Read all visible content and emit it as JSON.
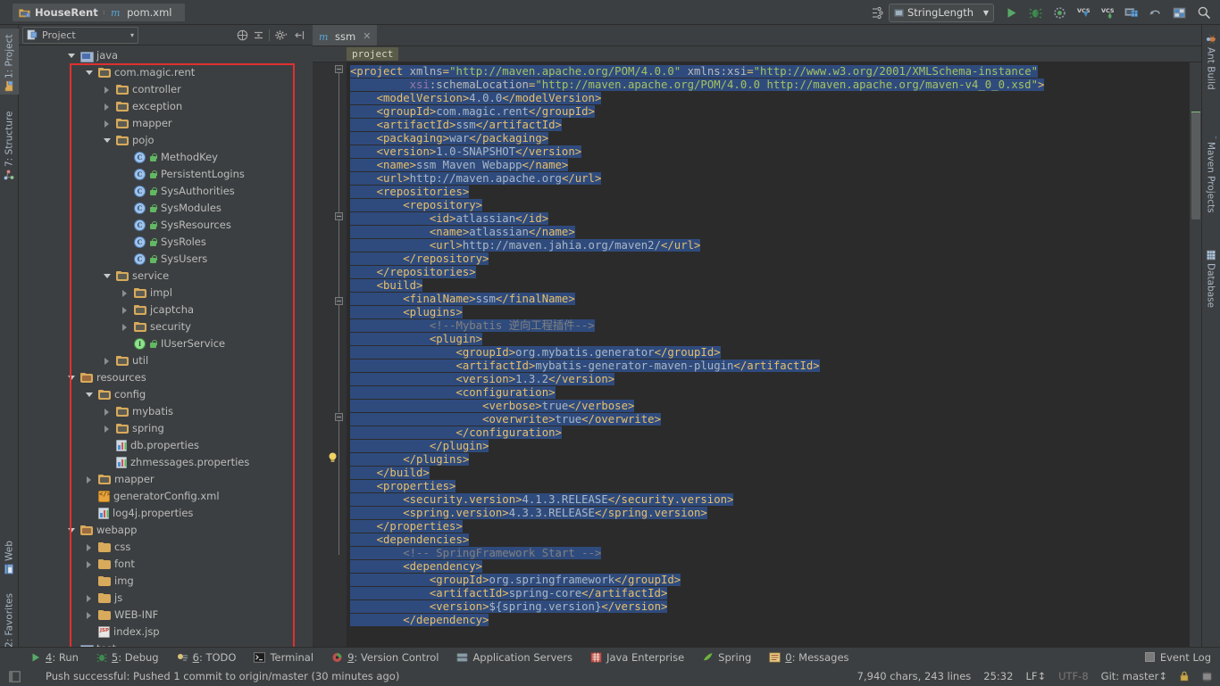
{
  "window": {
    "breadcrumb": [
      {
        "label": "HouseRent",
        "icon": "project-folder-icon"
      },
      {
        "label": "pom.xml",
        "icon": "maven-m-icon"
      }
    ],
    "separator": "›"
  },
  "toolbar": {
    "run_config": {
      "label": "StringLength",
      "caret": "▼"
    },
    "buttons": [
      {
        "name": "run-button",
        "glyph": "run"
      },
      {
        "name": "debug-button",
        "glyph": "debug"
      },
      {
        "name": "coverage-button",
        "glyph": "coverage"
      },
      {
        "name": "vcs-update-button",
        "glyph": "vcs-update"
      },
      {
        "name": "vcs-commit-button",
        "glyph": "vcs-commit"
      },
      {
        "name": "vcs-history-button",
        "glyph": "vcs-history"
      },
      {
        "name": "undo-button",
        "glyph": "undo"
      },
      {
        "name": "settings-button",
        "glyph": "settings"
      },
      {
        "name": "search-everywhere-button",
        "glyph": "search"
      }
    ],
    "left_icon": "toolbar-toggle-icon"
  },
  "left_tool_strip": [
    {
      "label": "1: Project",
      "selected": true,
      "icon": "project-icon"
    },
    {
      "label": "7: Structure",
      "selected": false,
      "icon": "structure-icon"
    },
    {
      "label": "Web",
      "selected": false,
      "icon": "web-icon"
    },
    {
      "label": "2: Favorites",
      "selected": false,
      "icon": "favorites-star-icon"
    }
  ],
  "right_tool_strip": [
    {
      "label": "Ant Build",
      "icon": "ant-icon"
    },
    {
      "label": "Maven Projects",
      "icon": "maven-m-icon"
    },
    {
      "label": "Database",
      "icon": "database-icon"
    }
  ],
  "project_panel": {
    "title": "Project",
    "title_caret": "▾",
    "header_icons": [
      {
        "name": "collapse-all-icon"
      },
      {
        "name": "expand-all-icon"
      },
      {
        "name": "settings-gear-icon"
      },
      {
        "name": "hide-panel-icon"
      }
    ],
    "tree": [
      {
        "depth": 1,
        "arrow": "open",
        "icon": "module-source-icon",
        "label": "java",
        "kind": "folder-src"
      },
      {
        "depth": 2,
        "arrow": "open",
        "icon": "package-icon",
        "label": "com.magic.rent",
        "kind": "folder-pkg"
      },
      {
        "depth": 3,
        "arrow": "closed",
        "icon": "package-icon",
        "label": "controller",
        "kind": "folder-pkg"
      },
      {
        "depth": 3,
        "arrow": "closed",
        "icon": "package-icon",
        "label": "exception",
        "kind": "folder-pkg"
      },
      {
        "depth": 3,
        "arrow": "closed",
        "icon": "package-icon",
        "label": "mapper",
        "kind": "folder-pkg"
      },
      {
        "depth": 3,
        "arrow": "open",
        "icon": "package-icon",
        "label": "pojo",
        "kind": "folder-pkg"
      },
      {
        "depth": 4,
        "arrow": "none",
        "icon": "java-class-icon",
        "label": "MethodKey",
        "kind": "class"
      },
      {
        "depth": 4,
        "arrow": "none",
        "icon": "java-class-icon",
        "label": "PersistentLogins",
        "kind": "class"
      },
      {
        "depth": 4,
        "arrow": "none",
        "icon": "java-class-icon",
        "label": "SysAuthorities",
        "kind": "class"
      },
      {
        "depth": 4,
        "arrow": "none",
        "icon": "java-class-icon",
        "label": "SysModules",
        "kind": "class"
      },
      {
        "depth": 4,
        "arrow": "none",
        "icon": "java-class-icon",
        "label": "SysResources",
        "kind": "class"
      },
      {
        "depth": 4,
        "arrow": "none",
        "icon": "java-class-icon",
        "label": "SysRoles",
        "kind": "class"
      },
      {
        "depth": 4,
        "arrow": "none",
        "icon": "java-class-icon",
        "label": "SysUsers",
        "kind": "class"
      },
      {
        "depth": 3,
        "arrow": "open",
        "icon": "package-icon",
        "label": "service",
        "kind": "folder-pkg"
      },
      {
        "depth": 4,
        "arrow": "closed",
        "icon": "package-icon",
        "label": "impl",
        "kind": "folder-pkg"
      },
      {
        "depth": 4,
        "arrow": "closed",
        "icon": "package-icon",
        "label": "jcaptcha",
        "kind": "folder-pkg"
      },
      {
        "depth": 4,
        "arrow": "closed",
        "icon": "package-icon",
        "label": "security",
        "kind": "folder-pkg"
      },
      {
        "depth": 4,
        "arrow": "none",
        "icon": "java-interface-icon",
        "label": "IUserService",
        "kind": "interface"
      },
      {
        "depth": 3,
        "arrow": "closed",
        "icon": "package-icon",
        "label": "util",
        "kind": "folder-pkg"
      },
      {
        "depth": 1,
        "arrow": "open",
        "icon": "resources-root-icon",
        "label": "resources",
        "kind": "folder-res"
      },
      {
        "depth": 2,
        "arrow": "open",
        "icon": "folder-icon",
        "label": "config",
        "kind": "folder-pkg"
      },
      {
        "depth": 3,
        "arrow": "closed",
        "icon": "folder-icon",
        "label": "mybatis",
        "kind": "folder-pkg"
      },
      {
        "depth": 3,
        "arrow": "closed",
        "icon": "folder-icon",
        "label": "spring",
        "kind": "folder-pkg"
      },
      {
        "depth": 3,
        "arrow": "none",
        "icon": "properties-file-icon",
        "label": "db.properties",
        "kind": "properties"
      },
      {
        "depth": 3,
        "arrow": "none",
        "icon": "properties-file-icon",
        "label": "zhmessages.properties",
        "kind": "properties"
      },
      {
        "depth": 2,
        "arrow": "closed",
        "icon": "folder-icon",
        "label": "mapper",
        "kind": "folder-pkg"
      },
      {
        "depth": 2,
        "arrow": "none",
        "icon": "xml-file-icon",
        "label": "generatorConfig.xml",
        "kind": "xml"
      },
      {
        "depth": 2,
        "arrow": "none",
        "icon": "properties-file-icon",
        "label": "log4j.properties",
        "kind": "properties"
      },
      {
        "depth": 1,
        "arrow": "open",
        "icon": "webapp-root-icon",
        "label": "webapp",
        "kind": "folder-res"
      },
      {
        "depth": 2,
        "arrow": "closed",
        "icon": "folder-icon",
        "label": "css",
        "kind": "folder-plain"
      },
      {
        "depth": 2,
        "arrow": "closed",
        "icon": "folder-icon",
        "label": "font",
        "kind": "folder-plain"
      },
      {
        "depth": 2,
        "arrow": "none",
        "icon": "folder-icon",
        "label": "img",
        "kind": "folder-plain"
      },
      {
        "depth": 2,
        "arrow": "closed",
        "icon": "folder-icon",
        "label": "js",
        "kind": "folder-plain"
      },
      {
        "depth": 2,
        "arrow": "closed",
        "icon": "folder-icon",
        "label": "WEB-INF",
        "kind": "folder-plain"
      },
      {
        "depth": 2,
        "arrow": "none",
        "icon": "jsp-file-icon",
        "label": "index.jsp",
        "kind": "jsp"
      },
      {
        "depth": 1,
        "arrow": "open",
        "icon": "module-source-icon",
        "label": "test",
        "kind": "folder-src"
      }
    ],
    "highlight_color": "#e03030"
  },
  "editor": {
    "tab": {
      "label": "ssm",
      "icon": "maven-m-icon",
      "close": "✕"
    },
    "breadcrumb_chip": "project",
    "lines": [
      {
        "indent": 0,
        "parts": [
          {
            "t": "tag",
            "s": "<project "
          },
          {
            "t": "attr",
            "s": "xmlns"
          },
          {
            "t": "pun",
            "s": "="
          },
          {
            "t": "val",
            "s": "\"http://maven.apache.org/POM/4.0.0\""
          },
          {
            "t": "attr",
            "s": " xmlns:xsi"
          },
          {
            "t": "pun",
            "s": "="
          },
          {
            "t": "val",
            "s": "\"http://www.w3.org/2001/XMLSchema-instance\""
          }
        ]
      },
      {
        "indent": 9,
        "parts": [
          {
            "t": "attrns",
            "s": "xsi"
          },
          {
            "t": "attr",
            "s": ":schemaLocation"
          },
          {
            "t": "pun",
            "s": "="
          },
          {
            "t": "val",
            "s": "\"http://maven.apache.org/POM/4.0.0 http://maven.apache.org/maven-v4_0_0.xsd\""
          },
          {
            "t": "tag",
            "s": ">"
          }
        ]
      },
      {
        "indent": 4,
        "parts": [
          {
            "t": "tag",
            "s": "<modelVersion>"
          },
          {
            "t": "txt",
            "s": "4.0.0"
          },
          {
            "t": "tag",
            "s": "</modelVersion>"
          }
        ]
      },
      {
        "indent": 4,
        "parts": [
          {
            "t": "tag",
            "s": "<groupId>"
          },
          {
            "t": "txt",
            "s": "com.magic.rent"
          },
          {
            "t": "tag",
            "s": "</groupId>"
          }
        ]
      },
      {
        "indent": 4,
        "parts": [
          {
            "t": "tag",
            "s": "<artifactId>"
          },
          {
            "t": "txt",
            "s": "ssm"
          },
          {
            "t": "tag",
            "s": "</artifactId>"
          }
        ]
      },
      {
        "indent": 4,
        "parts": [
          {
            "t": "tag",
            "s": "<packaging>"
          },
          {
            "t": "txt",
            "s": "war"
          },
          {
            "t": "tag",
            "s": "</packaging>"
          }
        ]
      },
      {
        "indent": 4,
        "parts": [
          {
            "t": "tag",
            "s": "<version>"
          },
          {
            "t": "txt",
            "s": "1.0-SNAPSHOT"
          },
          {
            "t": "tag",
            "s": "</version>"
          }
        ]
      },
      {
        "indent": 4,
        "parts": [
          {
            "t": "tag",
            "s": "<name>"
          },
          {
            "t": "txt",
            "s": "ssm Maven Webapp"
          },
          {
            "t": "tag",
            "s": "</name>"
          }
        ]
      },
      {
        "indent": 4,
        "parts": [
          {
            "t": "tag",
            "s": "<url>"
          },
          {
            "t": "txt",
            "s": "http://maven.apache.org"
          },
          {
            "t": "tag",
            "s": "</url>"
          }
        ]
      },
      {
        "indent": 4,
        "parts": [
          {
            "t": "tag",
            "s": "<repositories>"
          }
        ]
      },
      {
        "indent": 8,
        "parts": [
          {
            "t": "tag",
            "s": "<repository>"
          }
        ]
      },
      {
        "indent": 12,
        "parts": [
          {
            "t": "tag",
            "s": "<id>"
          },
          {
            "t": "txt",
            "s": "atlassian"
          },
          {
            "t": "tag",
            "s": "</id>"
          }
        ]
      },
      {
        "indent": 12,
        "parts": [
          {
            "t": "tag",
            "s": "<name>"
          },
          {
            "t": "txt",
            "s": "atlassian"
          },
          {
            "t": "tag",
            "s": "</name>"
          }
        ]
      },
      {
        "indent": 12,
        "parts": [
          {
            "t": "tag",
            "s": "<url>"
          },
          {
            "t": "txt",
            "s": "http://maven.jahia.org/maven2/"
          },
          {
            "t": "tag",
            "s": "</url>"
          }
        ]
      },
      {
        "indent": 8,
        "parts": [
          {
            "t": "tag",
            "s": "</repository>"
          }
        ]
      },
      {
        "indent": 4,
        "parts": [
          {
            "t": "tag",
            "s": "</repositories>"
          }
        ]
      },
      {
        "indent": 4,
        "parts": [
          {
            "t": "tag",
            "s": "<build>"
          }
        ]
      },
      {
        "indent": 8,
        "parts": [
          {
            "t": "tag",
            "s": "<finalName>"
          },
          {
            "t": "txt",
            "s": "ssm"
          },
          {
            "t": "tag",
            "s": "</finalName>"
          }
        ]
      },
      {
        "indent": 8,
        "parts": [
          {
            "t": "tag",
            "s": "<plugins>"
          }
        ]
      },
      {
        "indent": 12,
        "parts": [
          {
            "t": "cmt",
            "s": "<!--Mybatis 逆向工程插件-->"
          }
        ]
      },
      {
        "indent": 12,
        "parts": [
          {
            "t": "tag",
            "s": "<plugin>"
          }
        ]
      },
      {
        "indent": 16,
        "parts": [
          {
            "t": "tag",
            "s": "<groupId>"
          },
          {
            "t": "txt",
            "s": "org.mybatis.generator"
          },
          {
            "t": "tag",
            "s": "</groupId>"
          }
        ]
      },
      {
        "indent": 16,
        "parts": [
          {
            "t": "tag",
            "s": "<artifactId>"
          },
          {
            "t": "txt",
            "s": "mybatis-generator-maven-plugin"
          },
          {
            "t": "tag",
            "s": "</artifactId>"
          }
        ]
      },
      {
        "indent": 16,
        "parts": [
          {
            "t": "tag",
            "s": "<version>"
          },
          {
            "t": "txt",
            "s": "1.3.2"
          },
          {
            "t": "tag",
            "s": "</version>"
          }
        ]
      },
      {
        "indent": 16,
        "parts": [
          {
            "t": "tag",
            "s": "<configuration>"
          }
        ]
      },
      {
        "indent": 20,
        "parts": [
          {
            "t": "tag",
            "s": "<verbose>"
          },
          {
            "t": "txt",
            "s": "true"
          },
          {
            "t": "tag",
            "s": "</verbose>"
          }
        ]
      },
      {
        "indent": 20,
        "parts": [
          {
            "t": "tag",
            "s": "<overwrite>"
          },
          {
            "t": "txt",
            "s": "true"
          },
          {
            "t": "tag",
            "s": "</overwrite>"
          }
        ]
      },
      {
        "indent": 16,
        "parts": [
          {
            "t": "tag",
            "s": "</configuration>"
          }
        ]
      },
      {
        "indent": 12,
        "parts": [
          {
            "t": "tag",
            "s": "</plugin>"
          }
        ]
      },
      {
        "indent": 8,
        "parts": [
          {
            "t": "tag",
            "s": "</plugins>"
          }
        ]
      },
      {
        "indent": 4,
        "parts": [
          {
            "t": "tag",
            "s": "</build>"
          }
        ]
      },
      {
        "indent": 4,
        "parts": [
          {
            "t": "tag",
            "s": "<properties>"
          }
        ]
      },
      {
        "indent": 8,
        "parts": [
          {
            "t": "tag",
            "s": "<security.version>"
          },
          {
            "t": "txt",
            "s": "4.1.3.RELEASE"
          },
          {
            "t": "tag",
            "s": "</security.version>"
          }
        ]
      },
      {
        "indent": 8,
        "parts": [
          {
            "t": "tag",
            "s": "<spring.version>"
          },
          {
            "t": "txt",
            "s": "4.3.3.RELEASE"
          },
          {
            "t": "tag",
            "s": "</spring.version>"
          }
        ]
      },
      {
        "indent": 4,
        "parts": [
          {
            "t": "tag",
            "s": "</properties>"
          }
        ]
      },
      {
        "indent": 4,
        "parts": [
          {
            "t": "tag",
            "s": "<dependencies>"
          }
        ]
      },
      {
        "indent": 8,
        "parts": [
          {
            "t": "cmt",
            "s": "<!-- SpringFramework Start -->"
          }
        ]
      },
      {
        "indent": 8,
        "parts": [
          {
            "t": "tag",
            "s": "<dependency>"
          }
        ]
      },
      {
        "indent": 12,
        "parts": [
          {
            "t": "tag",
            "s": "<groupId>"
          },
          {
            "t": "txt",
            "s": "org.springframework"
          },
          {
            "t": "tag",
            "s": "</groupId>"
          }
        ]
      },
      {
        "indent": 12,
        "parts": [
          {
            "t": "tag",
            "s": "<artifactId>"
          },
          {
            "t": "txt",
            "s": "spring-core"
          },
          {
            "t": "tag",
            "s": "</artifactId>"
          }
        ]
      },
      {
        "indent": 12,
        "parts": [
          {
            "t": "tag",
            "s": "<version>"
          },
          {
            "t": "txt",
            "s": "${spring.version}"
          },
          {
            "t": "tag",
            "s": "</version>"
          }
        ]
      },
      {
        "indent": 8,
        "parts": [
          {
            "t": "tag",
            "s": "</dependency>"
          }
        ]
      }
    ]
  },
  "bottom_tool_bar": {
    "tabs": [
      {
        "key": "4",
        "label": ": Run",
        "icon": "run-icon"
      },
      {
        "key": "5",
        "label": ": Debug",
        "icon": "debug-icon"
      },
      {
        "key": "6",
        "label": ": TODO",
        "icon": "todo-icon"
      },
      {
        "key": "",
        "label": "Terminal",
        "icon": "terminal-icon"
      },
      {
        "key": "9",
        "label": ": Version Control",
        "icon": "vcs-icon"
      },
      {
        "key": "",
        "label": "Application Servers",
        "icon": "app-servers-icon"
      },
      {
        "key": "",
        "label": "Java Enterprise",
        "icon": "java-enterprise-icon"
      },
      {
        "key": "",
        "label": "Spring",
        "icon": "spring-leaf-icon"
      },
      {
        "key": "0",
        "label": ": Messages",
        "icon": "messages-icon"
      }
    ],
    "event_log": {
      "label": "Event Log",
      "icon": "event-log-icon"
    }
  },
  "status_bar": {
    "message": "Push successful: Pushed 1 commit to origin/master (30 minutes ago)",
    "chars_lines": "7,940 chars, 243 lines",
    "caret_position": "25:32",
    "line_separator": "LF↕",
    "encoding": "UTF-8",
    "git_branch": "Git: master↕",
    "lock_icon": "read-only-lock-icon",
    "memory_icon": "memory-indicator-icon"
  }
}
